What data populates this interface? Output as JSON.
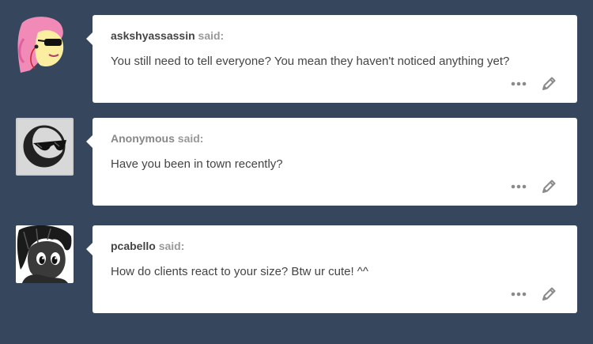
{
  "colors": {
    "background": "#36465d",
    "card": "#ffffff",
    "text": "#444444",
    "said": "#999999",
    "icon": "#8a8a8a"
  },
  "posts": [
    {
      "asker": "askshyassassin",
      "said": "said:",
      "question": "You still need to tell everyone? You mean they haven't noticed anything yet?",
      "avatar_icon": "pink-pony-avatar",
      "actions": [
        "more-icon",
        "edit-pencil-icon"
      ]
    },
    {
      "asker": "Anonymous",
      "said": "said:",
      "question": "Have you been in town recently?",
      "avatar_icon": "anonymous-sunglasses-avatar",
      "actions": [
        "more-icon",
        "edit-pencil-icon"
      ]
    },
    {
      "asker": "pcabello",
      "said": "said:",
      "question": "How do clients react to your size? Btw ur cute! ^^",
      "avatar_icon": "black-pony-avatar",
      "actions": [
        "more-icon",
        "edit-pencil-icon"
      ]
    }
  ]
}
